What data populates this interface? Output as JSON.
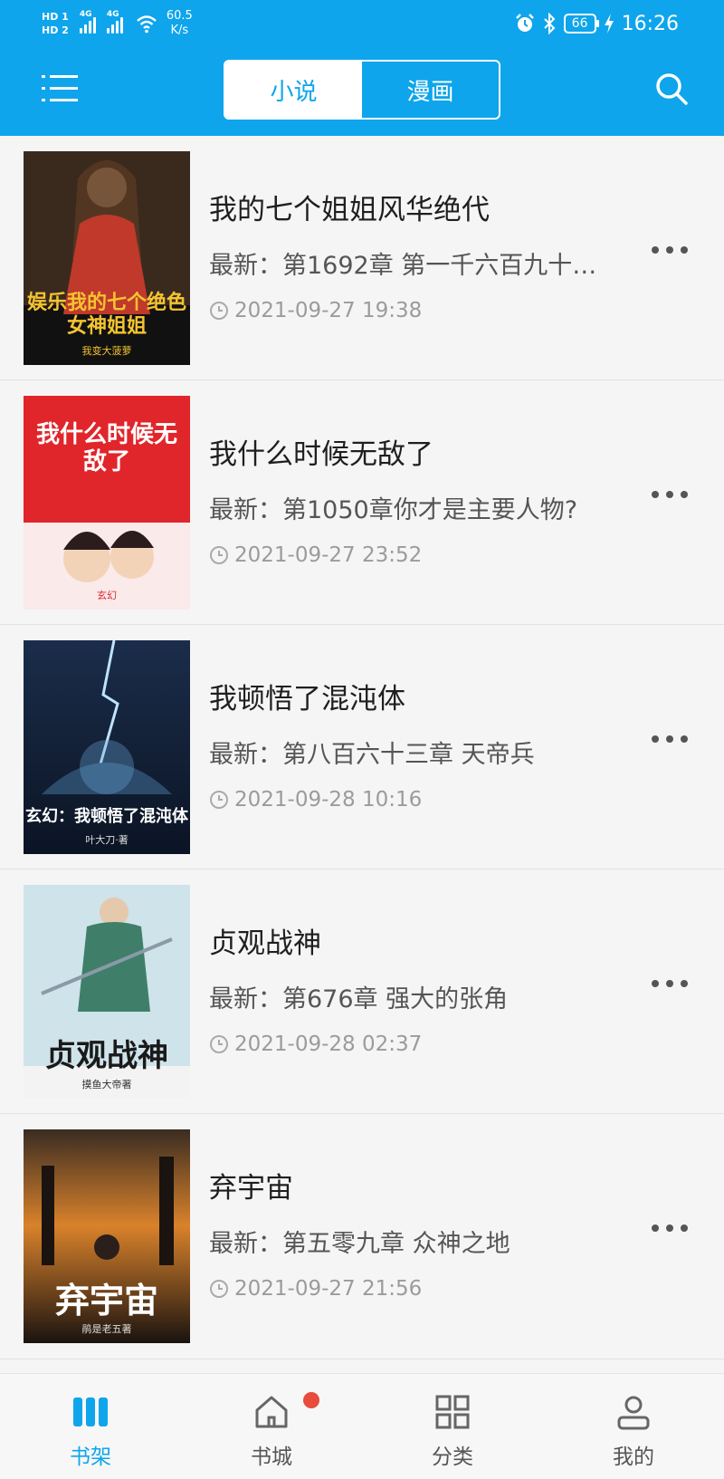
{
  "status_bar": {
    "hd1": "HD 1",
    "hd2": "HD 2",
    "net1": "4G",
    "net2": "4G",
    "speed_value": "60.5",
    "speed_unit": "K/s",
    "battery": "66",
    "time": "16:26"
  },
  "header": {
    "tabs": [
      {
        "label": "小说",
        "active": true
      },
      {
        "label": "漫画",
        "active": false
      }
    ]
  },
  "books": [
    {
      "title": "我的七个姐姐风华绝代",
      "latest": "最新：第1692章 第一千六百九十…",
      "time": "2021-09-27 19:38",
      "cover_text": "娱乐我的七个绝色女神姐姐",
      "cover_author": "我变大菠萝",
      "cover_bg": "#3a2a1e",
      "cover_accent": "#c0392b",
      "cover_text_color": "#f4c430"
    },
    {
      "title": "我什么时候无敌了",
      "latest": "最新：第1050章你才是主要人物?",
      "time": "2021-09-27 23:52",
      "cover_text": "我什么时候无敌了",
      "cover_author": "玄幻",
      "cover_bg": "#e0262b",
      "cover_accent": "#fbeaea",
      "cover_text_color": "#ffffff"
    },
    {
      "title": "我顿悟了混沌体",
      "latest": "最新：第八百六十三章 天帝兵",
      "time": "2021-09-28 10:16",
      "cover_text": "玄幻：我顿悟了混沌体",
      "cover_author": "叶大刀·著",
      "cover_bg": "#1b2d4a",
      "cover_accent": "#6aa7d6",
      "cover_text_color": "#ffffff"
    },
    {
      "title": "贞观战神",
      "latest": "最新：第676章 强大的张角",
      "time": "2021-09-28 02:37",
      "cover_text": "贞观战神",
      "cover_author": "摸鱼大帝著",
      "cover_bg": "#cfe3ea",
      "cover_accent": "#3f7f6a",
      "cover_text_color": "#1a1a1a"
    },
    {
      "title": "弃宇宙",
      "latest": "最新：第五零九章 众神之地",
      "time": "2021-09-27 21:56",
      "cover_text": "弃宇宙",
      "cover_author": "鹃是老五著",
      "cover_bg": "#2a1f1a",
      "cover_accent": "#d9822b",
      "cover_text_color": "#ffffff"
    }
  ],
  "bottom_nav": [
    {
      "label": "书架",
      "icon": "bookshelf-icon",
      "active": true
    },
    {
      "label": "书城",
      "icon": "home-icon",
      "active": false,
      "badge": true
    },
    {
      "label": "分类",
      "icon": "grid-icon",
      "active": false
    },
    {
      "label": "我的",
      "icon": "user-icon",
      "active": false
    }
  ],
  "colors": {
    "brand": "#0ea5ec",
    "badge": "#e74c3c"
  }
}
